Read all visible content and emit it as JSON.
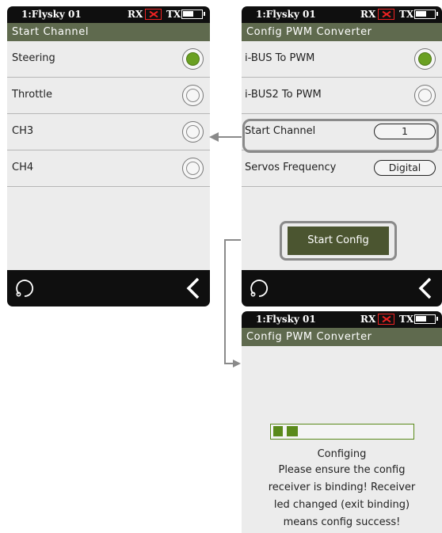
{
  "status": {
    "model": "1:Flysky 01",
    "rx": "RX",
    "tx": "TX"
  },
  "screen1": {
    "title": "Start Channel",
    "items": [
      {
        "label": "Steering",
        "selected": true
      },
      {
        "label": "Throttle",
        "selected": false
      },
      {
        "label": "CH3",
        "selected": false
      },
      {
        "label": "CH4",
        "selected": false
      }
    ]
  },
  "screen2": {
    "title": "Config PWM Converter",
    "options": [
      {
        "label": "i-BUS To PWM",
        "selected": true
      },
      {
        "label": "i-BUS2 To PWM",
        "selected": false
      }
    ],
    "start_channel": {
      "label": "Start Channel",
      "value": "1"
    },
    "servos_frequency": {
      "label": "Servos Frequency",
      "value": "Digital"
    },
    "start_button": "Start Config"
  },
  "screen3": {
    "title": "Config PWM Converter",
    "progress": 0.18,
    "status": "Configing",
    "message_lines": [
      "Please ensure the config",
      "receiver is binding! Receiver",
      "led changed (exit binding)",
      "means config success!"
    ]
  },
  "colors": {
    "accent": "#6aa022",
    "title_bar": "#5f6a4e",
    "button": "#4b5530",
    "rx_error": "#e22222"
  }
}
